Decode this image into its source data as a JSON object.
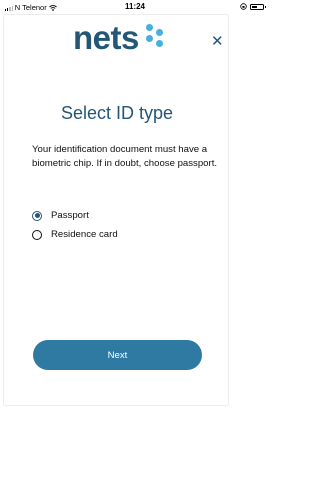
{
  "status_bar": {
    "carrier": "N Telenor",
    "time": "11:24"
  },
  "logo": {
    "text": "nets"
  },
  "title": "Select ID type",
  "description": "Your identification document must have a biometric chip. If in doubt, choose passport.",
  "options": [
    {
      "label": "Passport",
      "checked": true
    },
    {
      "label": "Residence card",
      "checked": false
    }
  ],
  "next_button": "Next",
  "colors": {
    "brand": "#235775",
    "accent": "#43b0dd",
    "button": "#2f7aa3"
  }
}
